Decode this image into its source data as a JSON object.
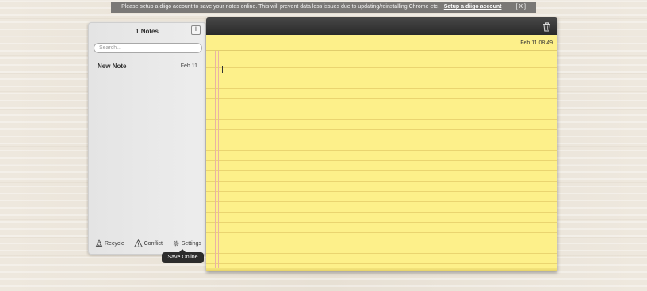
{
  "banner": {
    "message": "Please setup a diigo account to save your notes online. This will prevent data loss issues due to updating/reinstalling Chrome etc.",
    "link": "Setup a diigo account",
    "close": "[ X ]"
  },
  "sidebar": {
    "notes_count": "1 Notes",
    "add_icon": "plus-icon",
    "search_placeholder": "Search...",
    "notes": [
      {
        "title": "New Note",
        "date": "Feb 11"
      }
    ],
    "footer": {
      "recycle": "Recycle",
      "conflict": "Conflict",
      "settings": "Settings"
    },
    "tooltip": "Save Online"
  },
  "editor": {
    "timestamp": "Feb 11 08:49",
    "trash_icon": "trash-icon",
    "content": ""
  },
  "colors": {
    "paper": "#fdf08a",
    "toolbar": "#2e2e2e",
    "banner": "#7a7876",
    "margin_line": "#e9b3a4"
  }
}
